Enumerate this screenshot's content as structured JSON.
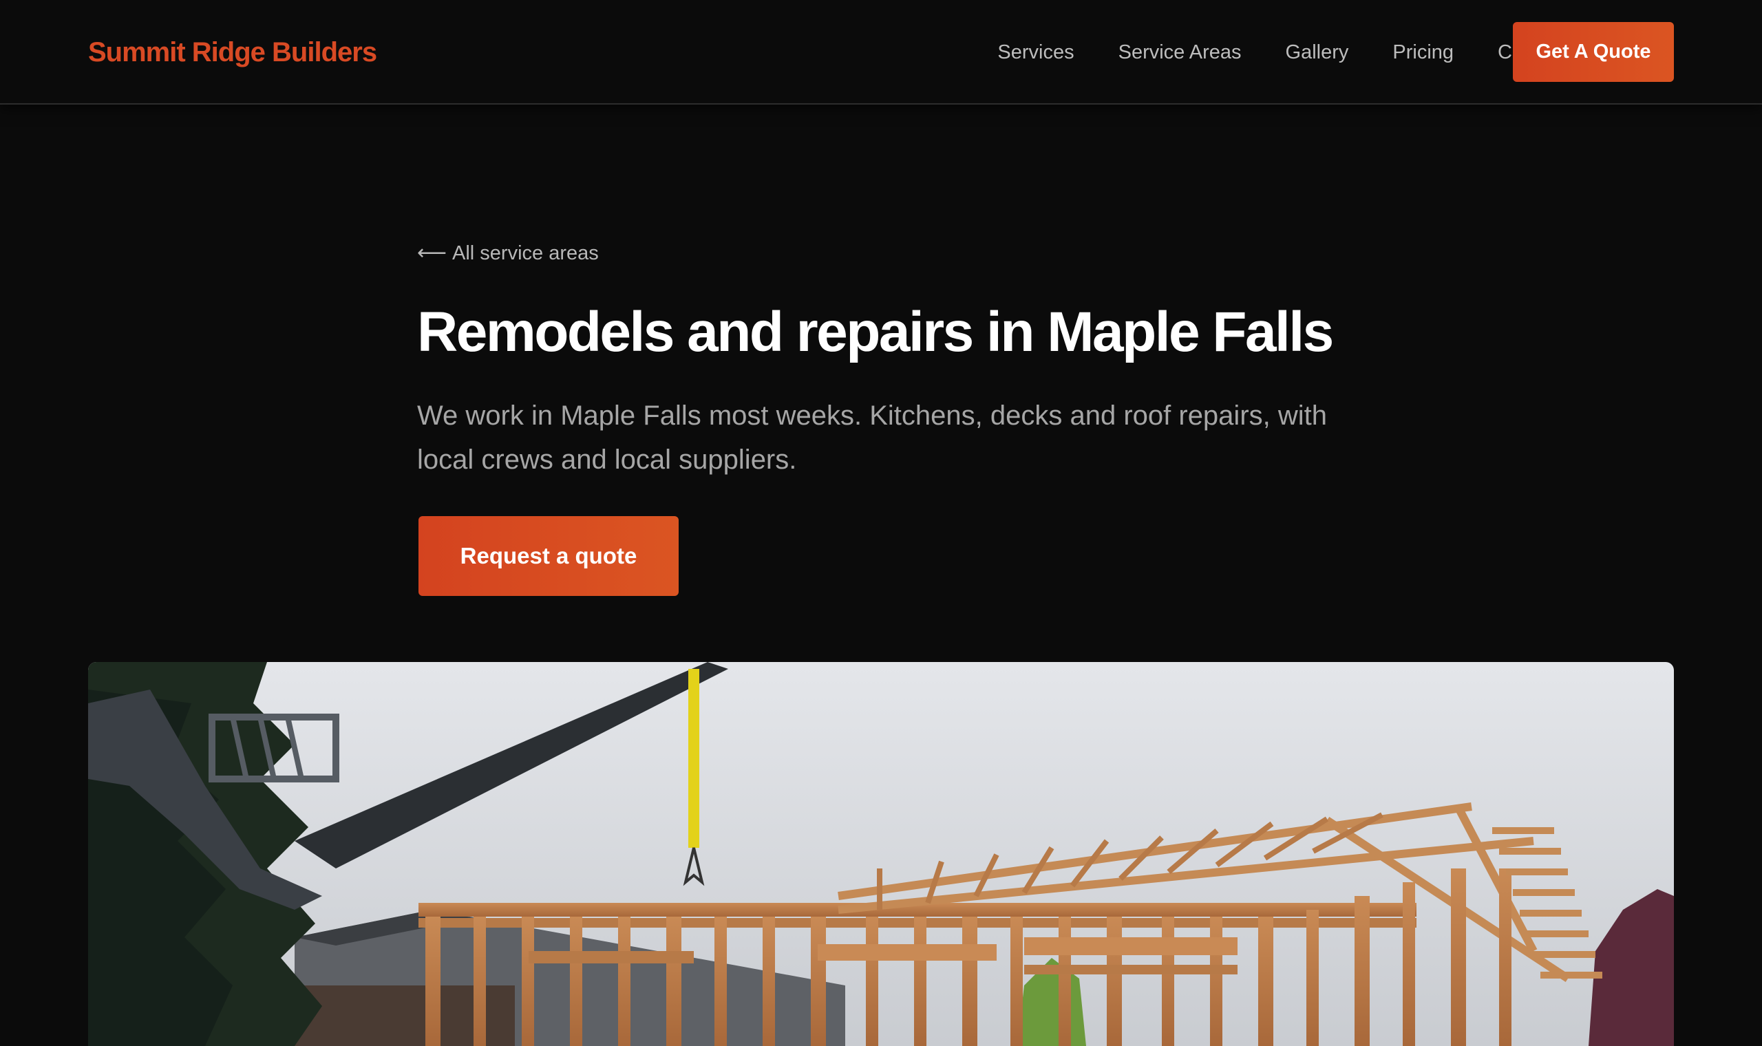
{
  "header": {
    "brand": "Summit Ridge Builders",
    "nav": [
      {
        "label": "Services"
      },
      {
        "label": "Service Areas"
      },
      {
        "label": "Gallery"
      },
      {
        "label": "Pricing"
      },
      {
        "label": "Contact"
      }
    ],
    "cta_label": "Get A Quote"
  },
  "main": {
    "back_label": "All service areas",
    "back_icon": "arrow-left-icon",
    "title": "Remodels and repairs in Maple Falls",
    "intro": "We work in Maple Falls most weeks. Kitchens, decks and roof repairs, with local crews and local suppliers.",
    "cta_label": "Request a quote"
  },
  "hero_image": {
    "subject": "construction-framing-photo"
  },
  "colors": {
    "accent": "#d84a24",
    "background": "#0b0b0b",
    "heading": "#ffffff",
    "body_text": "#a6a6a6",
    "nav_text": "#bdbdbd"
  }
}
